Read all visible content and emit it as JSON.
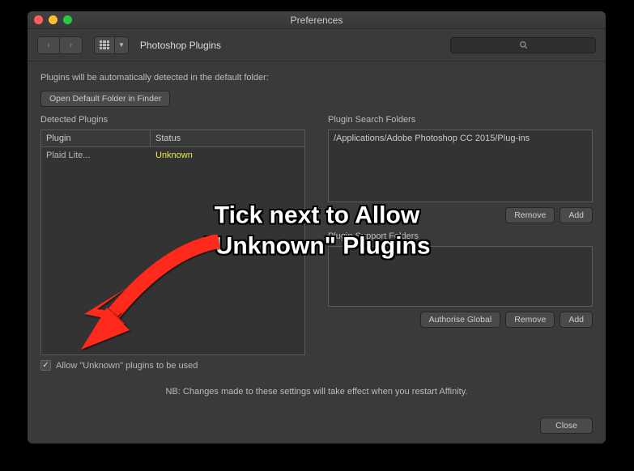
{
  "window": {
    "title": "Preferences",
    "breadcrumb": "Photoshop Plugins",
    "search_placeholder": ""
  },
  "main": {
    "auto_detect_label": "Plugins will be automatically detected in the default folder:",
    "open_default_btn": "Open Default Folder in Finder",
    "detected_section": "Detected Plugins",
    "detected_columns": {
      "plugin": "Plugin",
      "status": "Status"
    },
    "detected_rows": [
      {
        "plugin": "Plaid Lite...",
        "status": "Unknown"
      }
    ],
    "allow_unknown_label": "Allow \"Unknown\" plugins to be used",
    "allow_unknown_checked": true,
    "search_section": "Plugin Search Folders",
    "search_paths": [
      "/Applications/Adobe Photoshop CC 2015/Plug-ins"
    ],
    "support_section": "Plugin Support Folders",
    "remove_btn": "Remove",
    "add_btn": "Add",
    "authorise_btn": "Authorise Global",
    "footer_note": "NB: Changes made to these settings will take effect when you restart Affinity.",
    "close_btn": "Close"
  },
  "annotation": {
    "line1": "Tick next to Allow",
    "line2": "\"Unknown\" Plugins"
  }
}
